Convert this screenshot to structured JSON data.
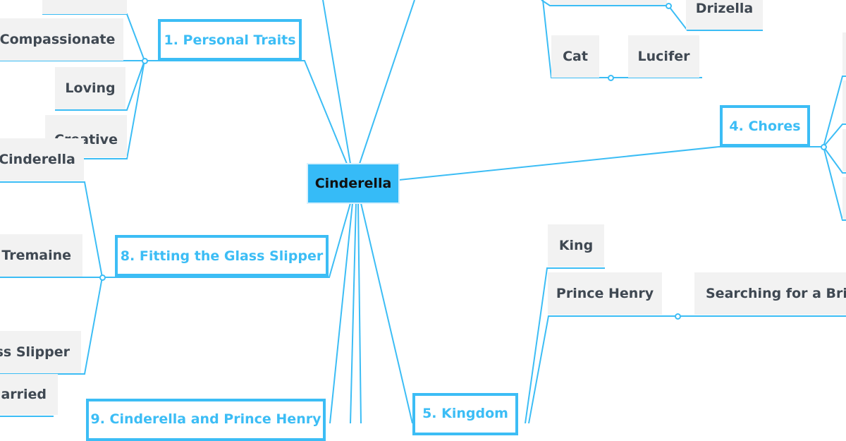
{
  "mindmap": {
    "accent_color": "#3cbdf5",
    "root": {
      "label": "Cinderella"
    },
    "branches": {
      "personal_traits": {
        "label": "1. Personal Traits",
        "children": [
          "Compassionate",
          "Loving",
          "Creative"
        ]
      },
      "chores": {
        "label": "4. Chores"
      },
      "kingdom": {
        "label": "5. Kingdom",
        "children": [
          "King",
          "Prince Henry"
        ],
        "prince_henry_child": "Searching for a Bride"
      },
      "fitting": {
        "label": "8. Fitting the Glass Slipper",
        "children": [
          "Cinderella",
          "Lady Tremaine",
          "Glass Slipper"
        ]
      },
      "cinderella_and_prince": {
        "label": "9. Cinderella and Prince Henry",
        "children": [
          "Married"
        ]
      }
    },
    "family": {
      "stepsister": "Drizella",
      "pet_type": "Cat",
      "pet_name": "Lucifer"
    }
  }
}
